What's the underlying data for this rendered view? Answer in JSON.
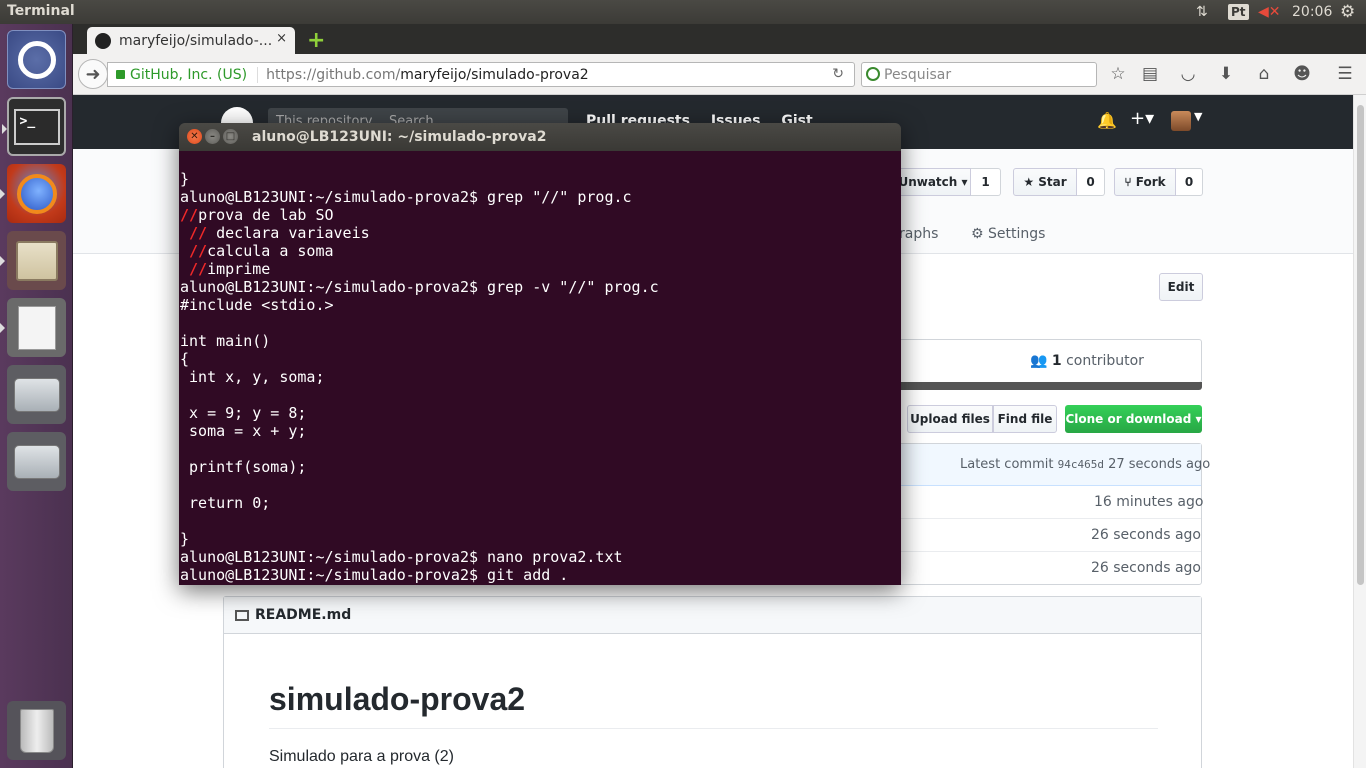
{
  "topbar": {
    "app_title": "Terminal",
    "lang_indicator": "Pt",
    "clock": "20:06"
  },
  "launcher": {
    "items": [
      "dash-home",
      "terminal",
      "firefox",
      "files",
      "text-editor",
      "disk-1",
      "disk-2",
      "trash"
    ]
  },
  "browser": {
    "tab_title": "maryfeijo/simulado-...",
    "tab_close": "×",
    "new_tab": "+",
    "identity": "GitHub, Inc. (US)",
    "url_prefix": "https://github.com/",
    "url_path": "maryfeijo/simulado-prova2",
    "search_placeholder": "Pesquisar"
  },
  "github": {
    "repo_search": "This repository",
    "repo_search_placeholder": "Search",
    "nav": [
      "Pull requests",
      "Issues",
      "Gist"
    ],
    "unwatch_label": "Unwatch",
    "unwatch_count": "1",
    "star_label": "Star",
    "star_count": "0",
    "fork_label": "Fork",
    "fork_count": "0",
    "tab_graphs": "raphs",
    "tab_settings": "Settings",
    "edit_label": "Edit",
    "contributors_count": "1",
    "contributors_label": "contributor",
    "upload_label": "Upload files",
    "find_label": "Find file",
    "clone_label": "Clone or download",
    "latest_commit_label": "Latest commit",
    "latest_commit_hash": "94c465d",
    "latest_commit_age": "27 seconds ago",
    "file_ages": [
      "16 minutes ago",
      "26 seconds ago",
      "26 seconds ago"
    ],
    "readme_title": "README.md",
    "readme_h1": "simulado-prova2",
    "readme_text": "Simulado para a prova (2)"
  },
  "terminal": {
    "title": "aluno@LB123UNI: ~/simulado-prova2",
    "lines": [
      {
        "pre": "",
        "hl": "",
        "post": "}"
      },
      {
        "pre": "aluno@LB123UNI:~/simulado-prova2$ grep \"//\" prog.c",
        "hl": "",
        "post": ""
      },
      {
        "pre": "",
        "hl": "//",
        "post": "prova de lab SO"
      },
      {
        "pre": " ",
        "hl": "//",
        "post": " declara variaveis"
      },
      {
        "pre": " ",
        "hl": "//",
        "post": "calcula a soma"
      },
      {
        "pre": " ",
        "hl": "//",
        "post": "imprime"
      },
      {
        "pre": "aluno@LB123UNI:~/simulado-prova2$ grep -v \"//\" prog.c",
        "hl": "",
        "post": ""
      },
      {
        "pre": "#include <stdio.>",
        "hl": "",
        "post": ""
      },
      {
        "pre": "",
        "hl": "",
        "post": ""
      },
      {
        "pre": "int main()",
        "hl": "",
        "post": ""
      },
      {
        "pre": "{",
        "hl": "",
        "post": ""
      },
      {
        "pre": " int x, y, soma;",
        "hl": "",
        "post": ""
      },
      {
        "pre": "",
        "hl": "",
        "post": ""
      },
      {
        "pre": " x = 9; y = 8;",
        "hl": "",
        "post": ""
      },
      {
        "pre": " soma = x + y;",
        "hl": "",
        "post": ""
      },
      {
        "pre": "",
        "hl": "",
        "post": ""
      },
      {
        "pre": " printf(soma);",
        "hl": "",
        "post": ""
      },
      {
        "pre": "",
        "hl": "",
        "post": ""
      },
      {
        "pre": " return 0;",
        "hl": "",
        "post": ""
      },
      {
        "pre": "",
        "hl": "",
        "post": ""
      },
      {
        "pre": "}",
        "hl": "",
        "post": ""
      },
      {
        "pre": "aluno@LB123UNI:~/simulado-prova2$ nano prova2.txt",
        "hl": "",
        "post": ""
      },
      {
        "pre": "aluno@LB123UNI:~/simulado-prova2$ git add .",
        "hl": "",
        "post": ""
      }
    ]
  }
}
